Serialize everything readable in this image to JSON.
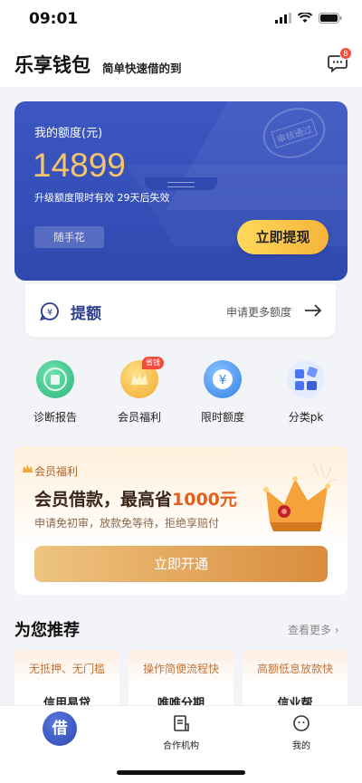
{
  "status_bar": {
    "time": "09:01"
  },
  "header": {
    "title": "乐享钱包",
    "subtitle": "简单快速借的到",
    "message_badge": "8"
  },
  "credit_card": {
    "label": "我的额度(元)",
    "amount": "14899",
    "note": "升级额度限时有效 29天后失效",
    "tag": "随手花",
    "withdraw_button": "立即提现",
    "stamp_text": "审核通过"
  },
  "raise_limit": {
    "label": "提额",
    "more": "申请更多额度"
  },
  "quick_grid": [
    {
      "label": "诊断报告",
      "icon": "report-icon",
      "color": "#3cc98c"
    },
    {
      "label": "会员福利",
      "icon": "crown-icon",
      "color": "#f7b733",
      "badge": "省钱"
    },
    {
      "label": "限时额度",
      "icon": "yen-icon",
      "color": "#3a8ef0"
    },
    {
      "label": "分类pk",
      "icon": "grid-icon",
      "color": "#4b74f0"
    }
  ],
  "member": {
    "tag": "会员福利",
    "title_prefix": "会员借款，最高省",
    "title_highlight": "1000元",
    "subtitle": "申请免初审，放款免等待，拒绝享赔付",
    "button": "立即开通"
  },
  "recommend": {
    "title": "为您推荐",
    "more": "查看更多",
    "cards": [
      {
        "tag": "无抵押、无门槛",
        "name": "信用易贷"
      },
      {
        "tag": "操作简便流程快",
        "name": "唯唯分期"
      },
      {
        "tag": "高额低息放款快",
        "name": "信业帮"
      }
    ]
  },
  "tab_bar": {
    "tabs": [
      {
        "label": "借",
        "icon": "borrow-icon"
      },
      {
        "label": "合作机构",
        "icon": "document-icon"
      },
      {
        "label": "我的",
        "icon": "profile-icon"
      }
    ]
  },
  "colors": {
    "primary": "#3149b3",
    "gold": "#f6c46b",
    "accent": "#e0601e"
  }
}
